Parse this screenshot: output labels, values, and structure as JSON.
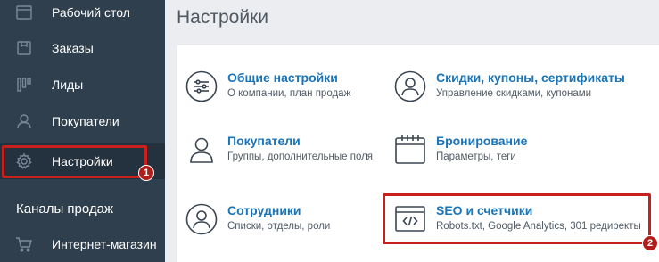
{
  "sidebar": {
    "items": [
      {
        "label": "Рабочий стол",
        "icon": "desktop-icon"
      },
      {
        "label": "Заказы",
        "icon": "box-icon"
      },
      {
        "label": "Лиды",
        "icon": "funnel-icon"
      },
      {
        "label": "Покупатели",
        "icon": "person-icon"
      },
      {
        "label": "Настройки",
        "icon": "gear-icon"
      }
    ],
    "section_title": "Каналы продаж",
    "channels": [
      {
        "label": "Интернет-магазин",
        "icon": "cart-icon"
      }
    ]
  },
  "main": {
    "title": "Настройки",
    "tiles": [
      {
        "title": "Общие настройки",
        "desc": "О компании, план продаж",
        "icon": "sliders-icon"
      },
      {
        "title": "Скидки, купоны, сертификаты",
        "desc": "Управление скидками, купонами",
        "icon": "user-circle-icon"
      },
      {
        "title": "Покупатели",
        "desc": "Группы, дополнительные поля",
        "icon": "person-icon"
      },
      {
        "title": "Бронирование",
        "desc": "Параметры, теги",
        "icon": "calendar-icon"
      },
      {
        "title": "Сотрудники",
        "desc": "Списки, отделы, роли",
        "icon": "user-circle-icon"
      },
      {
        "title": "SEO и счетчики",
        "desc": "Robots.txt, Google Analytics, 301 редиректы",
        "icon": "code-window-icon"
      }
    ]
  },
  "annotations": {
    "badge_1": "1",
    "badge_2": "2",
    "highlight_color": "#c8201c"
  }
}
